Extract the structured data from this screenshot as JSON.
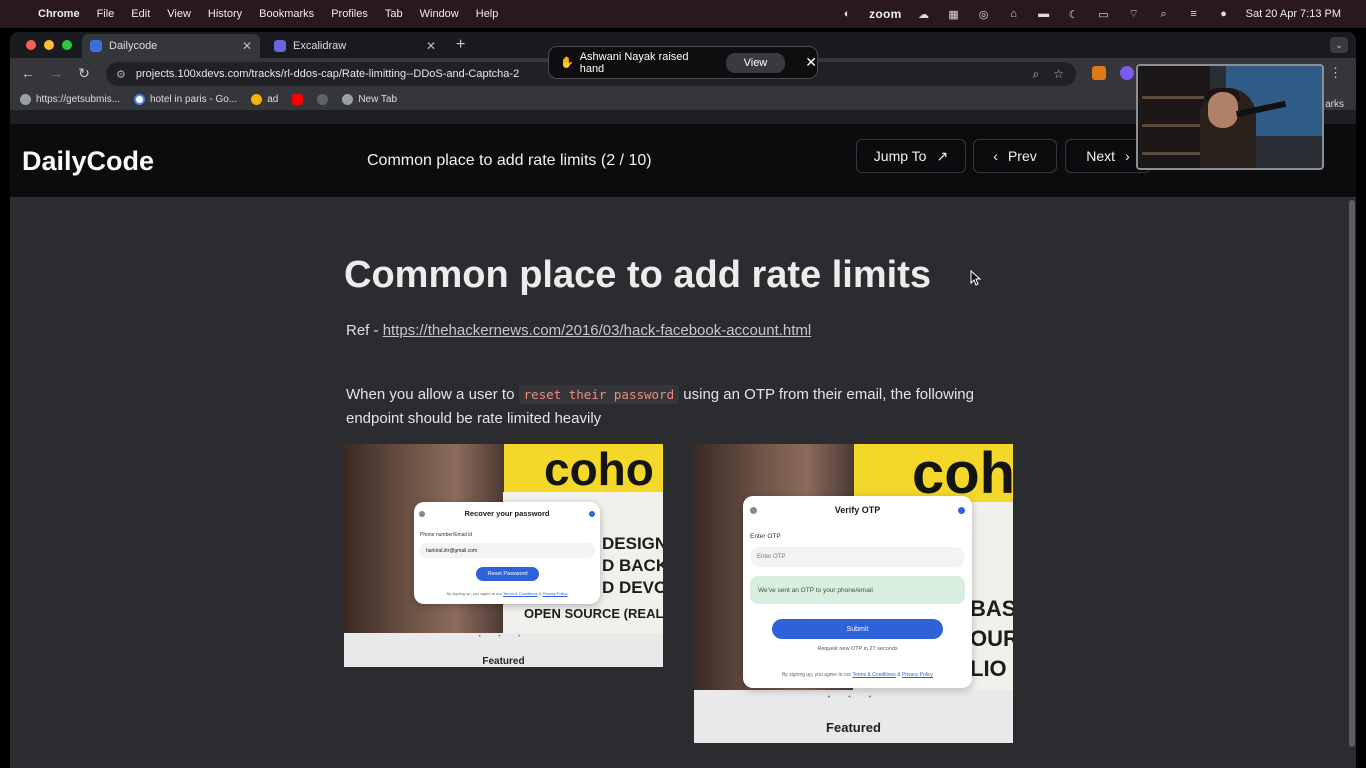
{
  "menubar": {
    "apple": "",
    "app_name": "Chrome",
    "menus": [
      "File",
      "Edit",
      "View",
      "History",
      "Bookmarks",
      "Profiles",
      "Tab",
      "Window",
      "Help"
    ],
    "zoom_label": "zoom",
    "datetime": "Sat 20 Apr  7:13 PM"
  },
  "tabs": [
    {
      "title": "Dailycode",
      "active": true
    },
    {
      "title": "Excalidraw",
      "active": false
    }
  ],
  "toolbar": {
    "url": "projects.100xdevs.com/tracks/rl-ddos-cap/Rate-limitting--DDoS-and-Captcha-2"
  },
  "bookmarks": [
    {
      "label": "https://getsubmis...",
      "icon": "globe-icon"
    },
    {
      "label": "hotel in paris - Go...",
      "icon": "google-icon"
    },
    {
      "label": "ad",
      "icon": "hand-icon"
    },
    {
      "label": "",
      "icon": "youtube-icon"
    },
    {
      "label": "",
      "icon": "settings-icon"
    },
    {
      "label": "New Tab",
      "icon": "globe-icon"
    }
  ],
  "bookmarks_right": "arks",
  "notification": {
    "text": "Ashwani Nayak raised hand",
    "emoji": "✋",
    "view_label": "View"
  },
  "site": {
    "logo": "DailyCode",
    "header_title": "Common place to add rate limits (2 / 10)",
    "jump_label": "Jump To",
    "prev_label": "Prev",
    "next_label": "Next"
  },
  "article": {
    "heading": "Common place to add rate limits",
    "ref_prefix": "Ref - ",
    "ref_link": "https://thehackernews.com/2016/03/hack-facebook-account.html",
    "para_before": "When you allow a user to ",
    "para_code": "reset their password",
    "para_after": " using an OTP from their email, the following endpoint should be rate limited heavily"
  },
  "image_left": {
    "banner_word": "coho",
    "banner_lines": [
      "DESIGN",
      "D BACKEN",
      "D DEVOP",
      "OPEN SOURCE (REAL CON"
    ],
    "modal_title": "Recover your password",
    "field_label": "Phone number/Email id",
    "field_value": "harkirat.iitr@gmail.com",
    "button": "Reset Password",
    "fine_prefix": "By signing up, you agree to our ",
    "fine_terms": "Terms & Conditions",
    "fine_and": " & ",
    "fine_privacy": "Privacy Policy",
    "dots": "• • •",
    "featured": "Featured"
  },
  "image_right": {
    "banner_word": "coh",
    "banner_lines": [
      "BASI",
      "OURO",
      "LIO P"
    ],
    "modal_title": "Verify OTP",
    "field_label": "Enter OTP",
    "field_placeholder": "Enter OTP",
    "notice": "We've sent an OTP to your phone/email",
    "button": "Submit",
    "resend": "Request new OTP in 27 seconds",
    "fine_prefix": "By signing up, you agree to our ",
    "fine_terms": "Terms & Conditions",
    "fine_and": " & ",
    "fine_privacy": "Privacy Policy",
    "dots": "• • •",
    "featured": "Featured"
  },
  "colors": {
    "page_bg": "#2a2c30",
    "header_bg": "#0c0c0e",
    "code_text": "#ef8a80",
    "modal_button": "#2f62d8"
  }
}
